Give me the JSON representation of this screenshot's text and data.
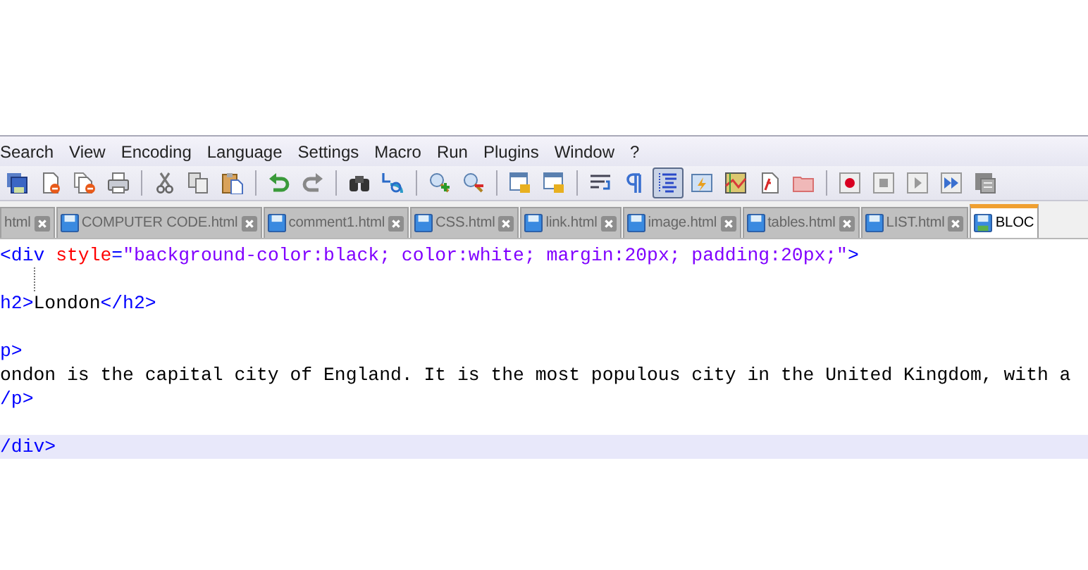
{
  "menu": [
    "Search",
    "View",
    "Encoding",
    "Language",
    "Settings",
    "Macro",
    "Run",
    "Plugins",
    "Window",
    "?"
  ],
  "toolbar": [
    [
      {
        "kind": "save-all",
        "pressed": false
      },
      {
        "kind": "close",
        "pressed": false
      },
      {
        "kind": "close-all",
        "pressed": false
      },
      {
        "kind": "print",
        "pressed": false
      }
    ],
    [
      {
        "kind": "cut",
        "pressed": false
      },
      {
        "kind": "copy",
        "pressed": false
      },
      {
        "kind": "paste",
        "pressed": false
      }
    ],
    [
      {
        "kind": "undo",
        "pressed": false
      },
      {
        "kind": "redo",
        "pressed": false
      }
    ],
    [
      {
        "kind": "find",
        "pressed": false
      },
      {
        "kind": "replace",
        "pressed": false
      }
    ],
    [
      {
        "kind": "zoom-in",
        "pressed": false
      },
      {
        "kind": "zoom-out",
        "pressed": false
      }
    ],
    [
      {
        "kind": "sync-v",
        "pressed": false
      },
      {
        "kind": "sync-h",
        "pressed": false
      }
    ],
    [
      {
        "kind": "wrap",
        "pressed": false
      },
      {
        "kind": "all-chars",
        "pressed": false
      },
      {
        "kind": "indent-guide",
        "pressed": true
      },
      {
        "kind": "lang",
        "pressed": false
      },
      {
        "kind": "doc-map",
        "pressed": false
      },
      {
        "kind": "function",
        "pressed": false
      },
      {
        "kind": "folder",
        "pressed": false
      }
    ],
    [
      {
        "kind": "record",
        "pressed": false
      },
      {
        "kind": "stop",
        "pressed": false
      },
      {
        "kind": "play",
        "pressed": false
      },
      {
        "kind": "play-multi",
        "pressed": false
      },
      {
        "kind": "save-macro",
        "pressed": false
      }
    ]
  ],
  "tabs": [
    {
      "label": "html",
      "selected": false
    },
    {
      "label": "COMPUTER CODE.html",
      "selected": false
    },
    {
      "label": "comment1.html",
      "selected": false
    },
    {
      "label": "CSS.html",
      "selected": false
    },
    {
      "label": "link.html",
      "selected": false
    },
    {
      "label": "image.html",
      "selected": false
    },
    {
      "label": "tables.html",
      "selected": false
    },
    {
      "label": "LIST.html",
      "selected": false
    },
    {
      "label": "BLOC",
      "selected": true
    }
  ],
  "editor": {
    "lines": [
      {
        "current": false,
        "guide": false,
        "tokens": [
          {
            "kind": "tag",
            "text": "<div "
          },
          {
            "kind": "attr",
            "text": "style"
          },
          {
            "kind": "tag",
            "text": "="
          },
          {
            "kind": "value",
            "text": "\"background-color:black; color:white; margin:20px; padding:20px;\""
          },
          {
            "kind": "tag",
            "text": ">"
          }
        ]
      },
      {
        "current": false,
        "guide": true
      },
      {
        "current": false,
        "guide": false,
        "tokens": [
          {
            "kind": "tag",
            "text": "h2>"
          },
          {
            "kind": "text",
            "text": "London"
          },
          {
            "kind": "tag",
            "text": "</h2>"
          }
        ]
      },
      {
        "current": false,
        "guide": false
      },
      {
        "current": false,
        "guide": false,
        "tokens": [
          {
            "kind": "tag",
            "text": "p>"
          }
        ]
      },
      {
        "current": false,
        "guide": false,
        "tokens": [
          {
            "kind": "text",
            "text": "ondon is the capital city of England. It is the most populous city in the United Kingdom, with a"
          }
        ]
      },
      {
        "current": false,
        "guide": false,
        "tokens": [
          {
            "kind": "tag",
            "text": "/p>"
          }
        ]
      },
      {
        "current": false,
        "guide": false
      },
      {
        "current": true,
        "guide": false,
        "tokens": [
          {
            "kind": "tag",
            "text": "/div>"
          }
        ]
      }
    ]
  }
}
